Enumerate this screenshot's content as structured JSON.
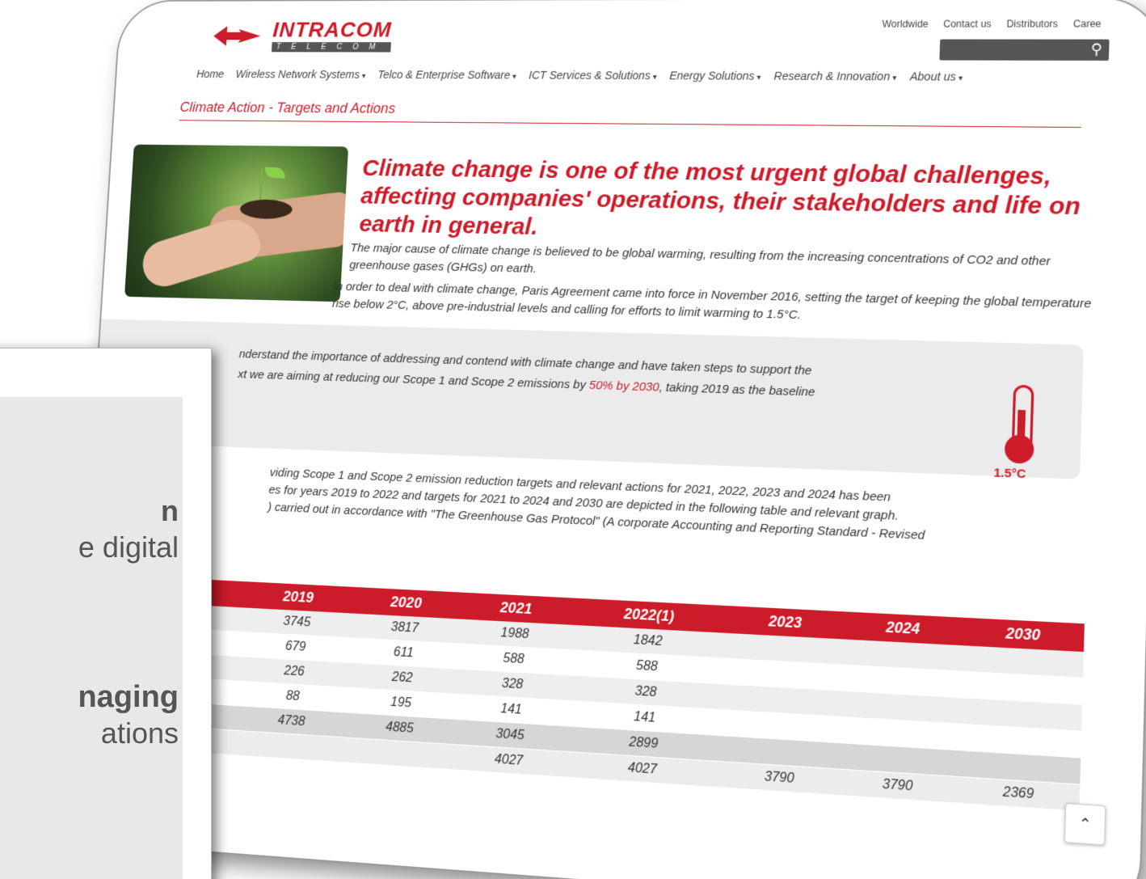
{
  "brand": {
    "name": "INTRACOM",
    "sub": "TELECOM",
    "accent": "#cc1c2a"
  },
  "toplinks": [
    "Worldwide",
    "Contact us",
    "Distributors",
    "Caree"
  ],
  "search_icon": "search-icon",
  "nav": [
    {
      "label": "Home",
      "caret": false
    },
    {
      "label": "Wireless Network Systems",
      "caret": true
    },
    {
      "label": "Telco & Enterprise Software",
      "caret": true
    },
    {
      "label": "ICT Services & Solutions",
      "caret": true
    },
    {
      "label": "Energy Solutions",
      "caret": true
    },
    {
      "label": "Research & Innovation",
      "caret": true
    },
    {
      "label": "About us",
      "caret": true
    }
  ],
  "page_title": "Climate Action - Targets and Actions",
  "headline": "Climate change is one of the most urgent global challenges, affecting companies' operations, their stakeholders and life on earth in general.",
  "para1": "The major cause of climate change is believed to be global warming, resulting from the increasing concentrations of CO2 and other greenhouse gases (GHGs) on earth.",
  "para2": "In order to deal with climate change, Paris Agreement came into force in November 2016, setting the target of keeping the global temperature rise below 2°C, above pre-industrial levels and calling for efforts to limit warming to 1.5°C.",
  "box": {
    "line1": "nderstand the importance of addressing and contend with climate change and have taken steps to support the",
    "line2a": "xt we are aiming at reducing our Scope 1 and Scope 2 emissions by ",
    "line2red": "50% by 2030",
    "line2b": ", taking 2019 as the baseline",
    "thermo_label": "1.5°C"
  },
  "para3_lines": [
    "viding Scope 1 and Scope 2 emission reduction targets and relevant actions for 2021, 2022, 2023 and 2024 has been",
    "es for years 2019 to 2022 and targets for 2021 to 2024 and 2030 are depicted in the following table and relevant graph.",
    ") carried out in accordance with \"The Greenhouse Gas Protocol\" (A corporate Accounting and Reporting Standard - Revised"
  ],
  "table": {
    "headers": [
      "",
      "2019",
      "2020",
      "2021",
      "2022(1)",
      "2023",
      "2024",
      "2030"
    ],
    "rows": [
      [
        "",
        "3745",
        "3817",
        "1988",
        "1842",
        "",
        "",
        ""
      ],
      [
        "",
        "679",
        "611",
        "588",
        "588",
        "",
        "",
        ""
      ],
      [
        "",
        "226",
        "262",
        "328",
        "328",
        "",
        "",
        ""
      ],
      [
        "",
        "88",
        "195",
        "141",
        "141",
        "",
        "",
        ""
      ],
      [
        "",
        "4738",
        "4885",
        "3045",
        "2899",
        "",
        "",
        ""
      ],
      [
        "",
        "",
        "",
        "4027",
        "4027",
        "3790",
        "3790",
        "2369"
      ]
    ]
  },
  "slide": {
    "line1": "n",
    "line2": "e digital",
    "line3": "naging",
    "line4": "ations"
  }
}
